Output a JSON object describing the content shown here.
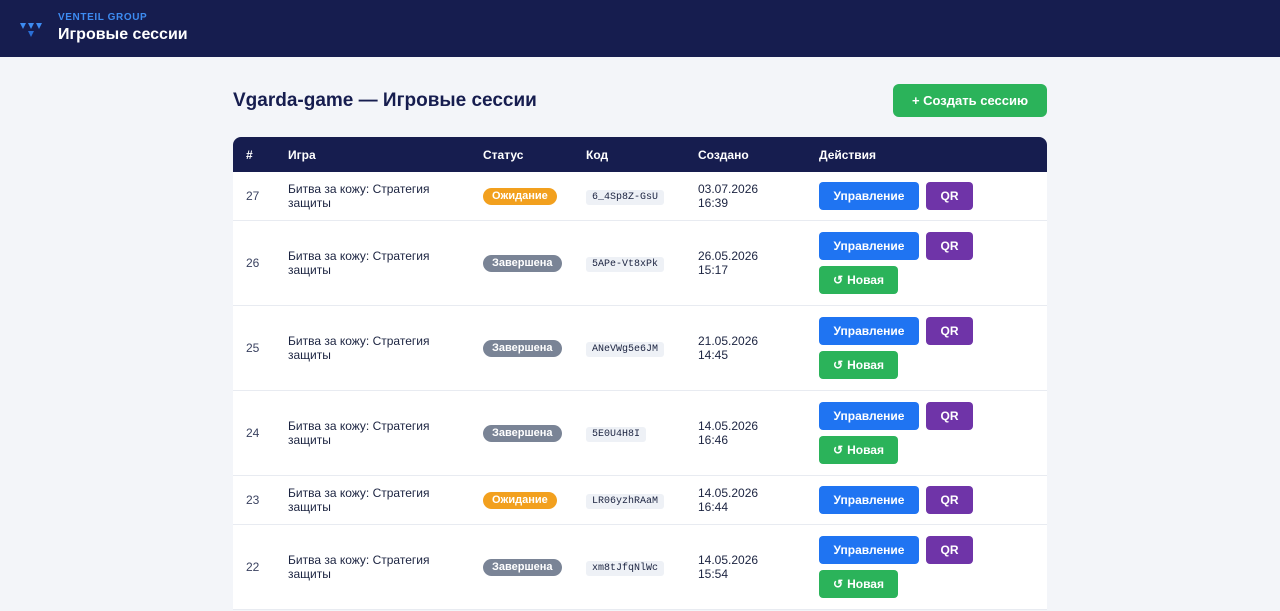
{
  "header": {
    "brand": "VENTEIL GROUP",
    "title": "Игровые сессии"
  },
  "page": {
    "title": "Vgarda-game — Игровые сессии",
    "create_button": "+ Создать сессию"
  },
  "table": {
    "columns": [
      "#",
      "Игра",
      "Статус",
      "Код",
      "Создано",
      "Действия"
    ],
    "buttons": {
      "manage": "Управление",
      "qr": "QR",
      "new": "Новая"
    },
    "rows": [
      {
        "num": "27",
        "game": "Битва за кожу: Стратегия защиты",
        "status": "Ожидание",
        "status_kind": "wait",
        "code": "6_4Sp8Z-GsU",
        "date": "03.07.2026",
        "time": "16:39",
        "has_new": false
      },
      {
        "num": "26",
        "game": "Битва за кожу: Стратегия защиты",
        "status": "Завершена",
        "status_kind": "done",
        "code": "5APe-Vt8xPk",
        "date": "26.05.2026",
        "time": "15:17",
        "has_new": true
      },
      {
        "num": "25",
        "game": "Битва за кожу: Стратегия защиты",
        "status": "Завершена",
        "status_kind": "done",
        "code": "ANeVWg5e6JM",
        "date": "21.05.2026",
        "time": "14:45",
        "has_new": true
      },
      {
        "num": "24",
        "game": "Битва за кожу: Стратегия защиты",
        "status": "Завершена",
        "status_kind": "done",
        "code": "5E0U4H8I",
        "date": "14.05.2026",
        "time": "16:46",
        "has_new": true
      },
      {
        "num": "23",
        "game": "Битва за кожу: Стратегия защиты",
        "status": "Ожидание",
        "status_kind": "wait",
        "code": "LR06yzhRAaM",
        "date": "14.05.2026",
        "time": "16:44",
        "has_new": false
      },
      {
        "num": "22",
        "game": "Битва за кожу: Стратегия защиты",
        "status": "Завершена",
        "status_kind": "done",
        "code": "xm8tJfqNlWc",
        "date": "14.05.2026",
        "time": "15:54",
        "has_new": true
      }
    ]
  },
  "colors": {
    "navy": "#161d4f",
    "blue": "#1f74f2",
    "purple": "#6f34a8",
    "green": "#2bb35a",
    "orange": "#f2a01e",
    "gray": "#7a8496"
  },
  "icons": {
    "logo": "venteil-logo-icon",
    "refresh": "refresh-icon"
  }
}
